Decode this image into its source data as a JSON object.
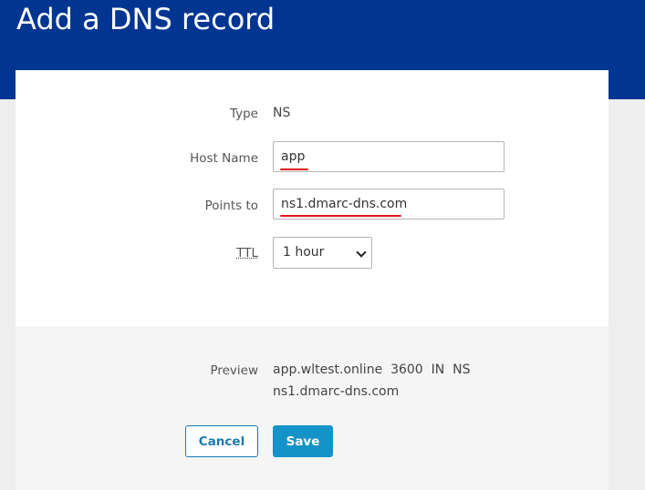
{
  "page": {
    "title": "Add a DNS record"
  },
  "form": {
    "type_label": "Type",
    "type_value": "NS",
    "host_label": "Host Name",
    "host_value": "app",
    "points_label": "Points to",
    "points_value": "ns1.dmarc-dns.com",
    "ttl_label": "TTL",
    "ttl_value": "1 hour"
  },
  "preview": {
    "label": "Preview",
    "line1": "app.wltest.online  3600  IN  NS",
    "line2": "ns1.dmarc-dns.com"
  },
  "actions": {
    "cancel_label": "Cancel",
    "save_label": "Save"
  },
  "colors": {
    "header": "#003591",
    "accent": "#1493c8",
    "annotation": "#e0161b"
  },
  "icons": {
    "ttl_dropdown": "chevron-down-icon"
  }
}
